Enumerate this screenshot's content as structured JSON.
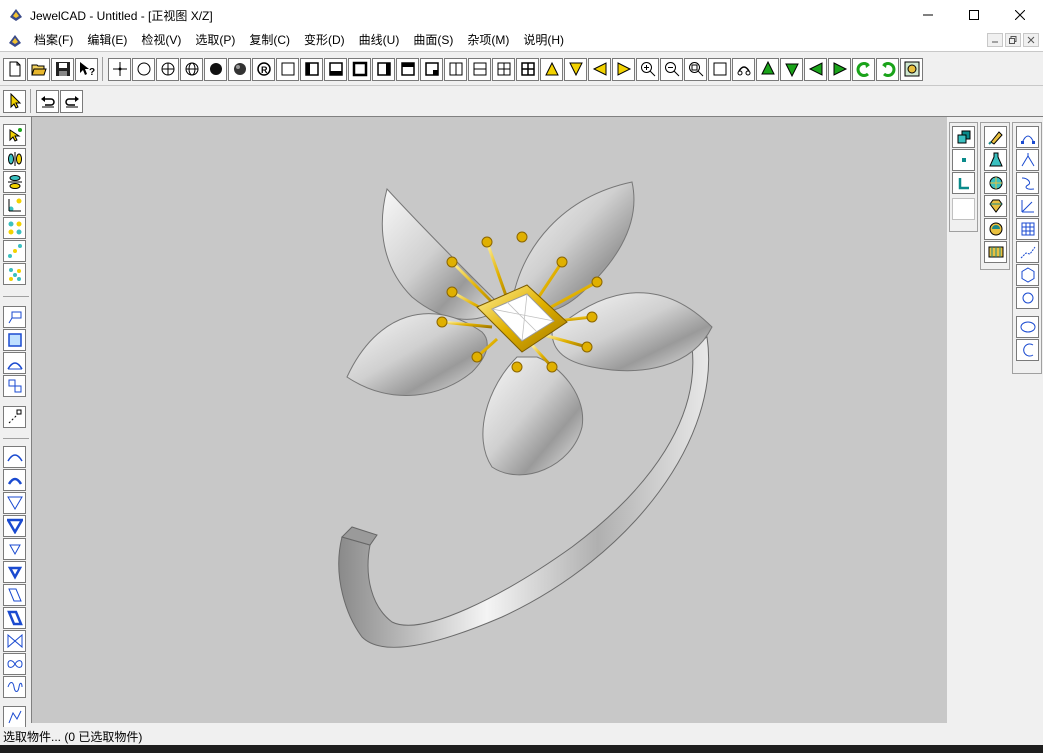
{
  "window": {
    "title": "JewelCAD - Untitled - [正视图 X/Z]",
    "controls": [
      "minimize-icon",
      "maximize-icon",
      "close-icon"
    ]
  },
  "menu": {
    "items": [
      "档案(F)",
      "编辑(E)",
      "检视(V)",
      "选取(P)",
      "复制(C)",
      "变形(D)",
      "曲线(U)",
      "曲面(S)",
      "杂项(M)",
      "说明(H)"
    ]
  },
  "toolbar_main": {
    "icons": [
      "new-file-icon",
      "open-folder-icon",
      "save-icon",
      "help-cursor-icon",
      "point-icon",
      "circle-icon",
      "sphere-cross-icon",
      "globe-icon",
      "solid-ball-icon",
      "textured-ball-icon",
      "render-icon",
      "view-full-icon",
      "view-left-icon",
      "view-bottom-icon",
      "view-center-icon",
      "view-right-icon",
      "view-top-icon",
      "view-corner-icon",
      "split-vertical-icon",
      "split-horizontal-icon",
      "split-four-icon",
      "split-grid-icon",
      "arrow-up-icon",
      "arrow-down-icon",
      "arrow-left-icon",
      "arrow-right-icon",
      "zoom-in-icon",
      "zoom-out-icon",
      "zoom-window-icon",
      "zoom-box-icon",
      "zoom-fit-icon",
      "pan-up-icon",
      "pan-down-icon",
      "pan-left-icon",
      "pan-right-icon",
      "rotate-left-icon",
      "rotate-right-icon",
      "view-3d-icon"
    ]
  },
  "toolbar_secondary": {
    "icons": [
      "select-arrow-icon",
      "undo-icon",
      "redo-icon"
    ]
  },
  "left_tools": {
    "icons": [
      "select-all-icon",
      "mirror-icon",
      "align-icon",
      "array-icon",
      "grid-array-icon",
      "diagonal-array-icon",
      "scatter-array-icon",
      "plane-icon",
      "frame-icon",
      "bend-icon",
      "twist-icon",
      "node-edit-icon",
      "arc-up-icon",
      "arc-rotate-icon",
      "taper-icon",
      "taper-bold-icon",
      "taper-small-icon",
      "taper-small-bold-icon",
      "skew-icon",
      "skew-bold-icon",
      "bow-tie-icon",
      "infinity-icon",
      "wave-icon",
      "custom-curve-icon"
    ]
  },
  "right_tools_a": {
    "icons": [
      "layer-stack-icon",
      "point-small-icon",
      "corner-icon",
      "blank-icon"
    ]
  },
  "right_tools_b": {
    "icons": [
      "brush-icon",
      "flask-icon",
      "globe-color-icon",
      "gem-icon",
      "material-icon",
      "texture-icon"
    ]
  },
  "right_tools_c": {
    "icons": [
      "curve-nodes-icon",
      "curve-fork-icon",
      "spiral-icon",
      "axis-icon",
      "mesh-icon",
      "polyline-icon",
      "hexagon-icon",
      "circle-small-icon",
      "ellipse-icon",
      "arc-icon"
    ]
  },
  "viewport": {
    "background": "#c8c8c8",
    "metal_color": "#d9d9d9",
    "gold_color": "#e0b000",
    "gem_color": "#ffffff"
  },
  "status": {
    "text": "选取物件... (0 已选取物件)"
  }
}
